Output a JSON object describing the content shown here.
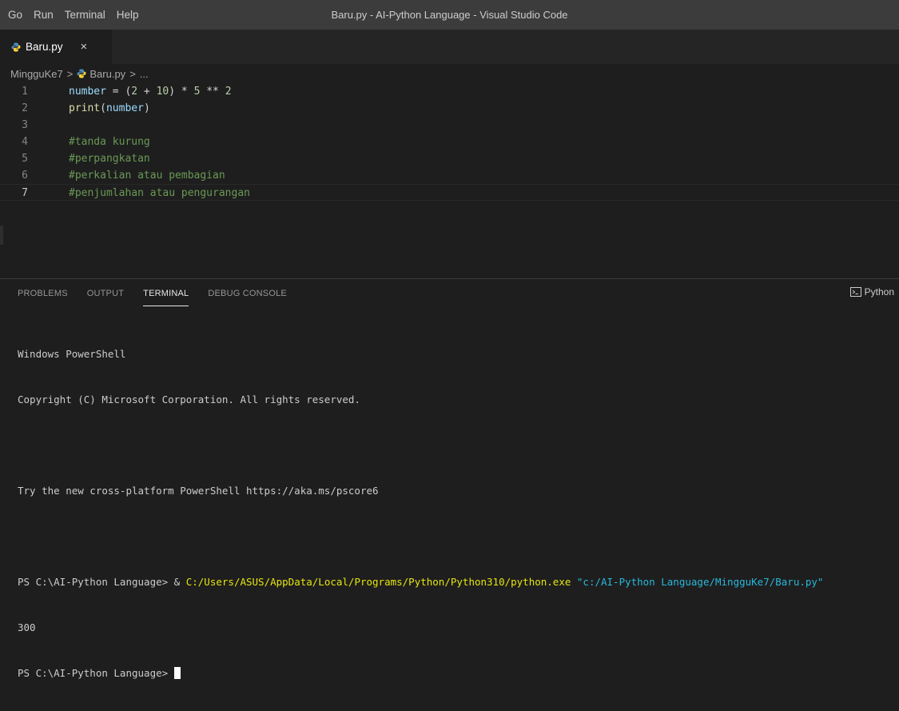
{
  "menu": {
    "items": [
      "Go",
      "Run",
      "Terminal",
      "Help"
    ]
  },
  "window": {
    "title": "Baru.py - AI-Python Language - Visual Studio Code"
  },
  "tab": {
    "label": "Baru.py",
    "close": "×"
  },
  "breadcrumb": {
    "folder": "MingguKe7",
    "sep": ">",
    "file": "Baru.py",
    "ellipsis": "..."
  },
  "editor": {
    "active_line": 7,
    "line_numbers": [
      "1",
      "2",
      "3",
      "4",
      "5",
      "6",
      "7"
    ],
    "line1": {
      "var": "number",
      "eq": " = (",
      "n1": "2",
      "plus": " + ",
      "n2": "10",
      "close": ") * ",
      "n3": "5",
      "pow": " ** ",
      "n4": "2"
    },
    "line2": {
      "fn": "print",
      "open": "(",
      "arg": "number",
      "close": ")"
    },
    "line4": "#tanda kurung",
    "line5": "#perpangkatan",
    "line6": "#perkalian atau pembagian",
    "line7": "#penjumlahan atau pengurangan"
  },
  "panel": {
    "tabs": [
      "PROBLEMS",
      "OUTPUT",
      "TERMINAL",
      "DEBUG CONSOLE"
    ],
    "active_tab": "TERMINAL",
    "shell_label": "Python"
  },
  "terminal": {
    "l1": "Windows PowerShell",
    "l2": "Copyright (C) Microsoft Corporation. All rights reserved.",
    "l3": "Try the new cross-platform PowerShell https://aka.ms/pscore6",
    "prompt": "PS C:\\AI-Python Language> ",
    "amp": "& ",
    "exe": "C:/Users/ASUS/AppData/Local/Programs/Python/Python310/python.exe",
    "script": " \"c:/AI-Python Language/MingguKe7/Baru.py\"",
    "output": "300",
    "prompt2": "PS C:\\AI-Python Language> "
  },
  "colors": {
    "keyword_var": "#9cdcfe",
    "function": "#dcdcaa",
    "number": "#b5cea8",
    "comment": "#6a9955",
    "terminal_path": "#e5e510",
    "terminal_string": "#29b8db"
  },
  "icons": {
    "file": "python-file-icon",
    "terminal": "terminal-icon"
  }
}
